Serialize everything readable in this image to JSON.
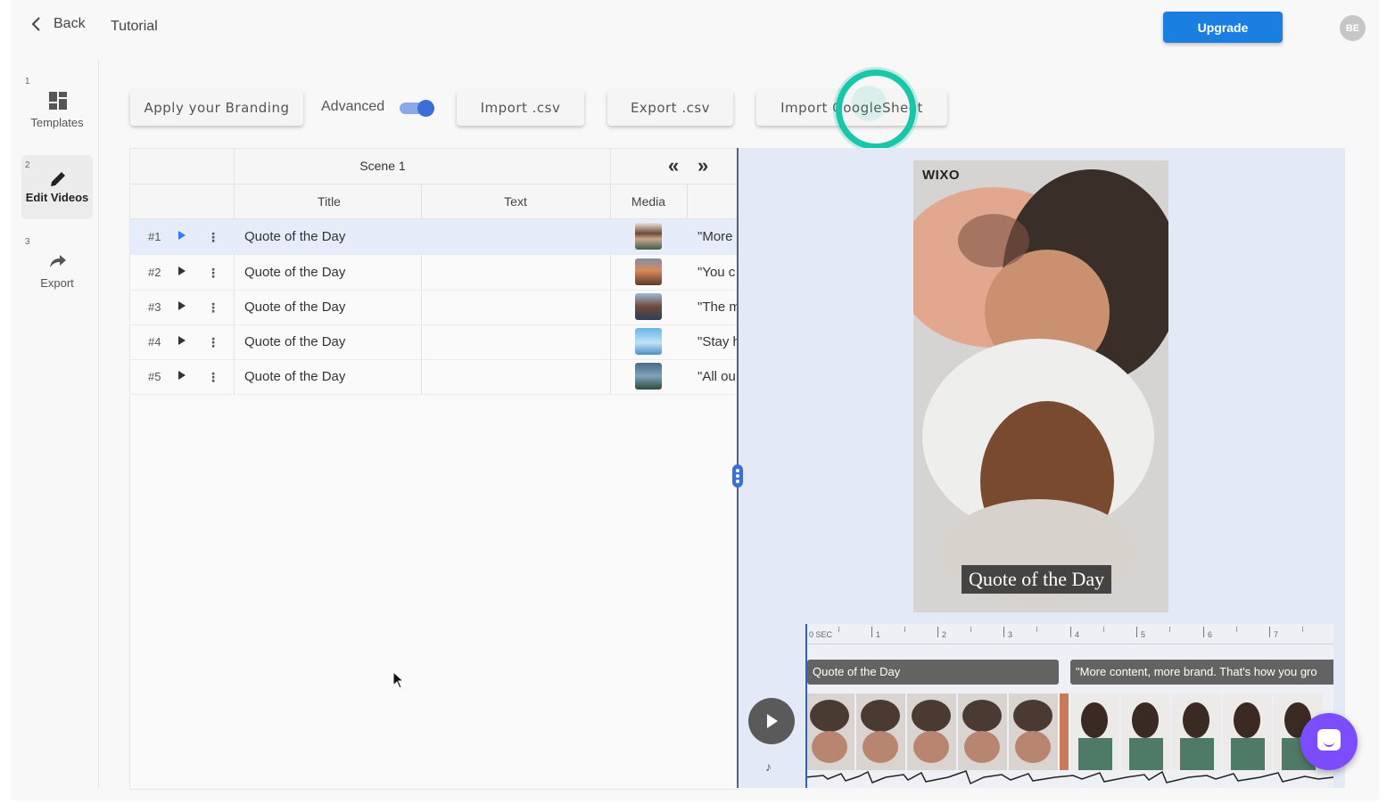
{
  "header": {
    "back_label": "Back",
    "title": "Tutorial",
    "upgrade_label": "Upgrade",
    "avatar_initials": "BE"
  },
  "sidebar": {
    "steps": [
      {
        "num": "1",
        "label": "Templates",
        "icon": "grid-icon"
      },
      {
        "num": "2",
        "label": "Edit Videos",
        "icon": "pencil-icon"
      },
      {
        "num": "3",
        "label": "Export",
        "icon": "share-icon"
      }
    ]
  },
  "toolbar": {
    "branding_label": "Apply your Branding",
    "advanced_label": "Advanced",
    "advanced_on": true,
    "import_csv_label": "Import .csv",
    "export_csv_label": "Export .csv",
    "import_sheet_label": "Import GoogleSheet"
  },
  "table": {
    "scene_label": "Scene 1",
    "prev_icon": "«",
    "next_icon": "»",
    "columns": [
      "Title",
      "Text",
      "Media"
    ],
    "rows": [
      {
        "num": "#1",
        "title": "Quote of the Day",
        "text": "",
        "quote": "\"More",
        "selected": true
      },
      {
        "num": "#2",
        "title": "Quote of the Day",
        "text": "",
        "quote": "\"You c",
        "selected": false
      },
      {
        "num": "#3",
        "title": "Quote of the Day",
        "text": "",
        "quote": "\"The m",
        "selected": false
      },
      {
        "num": "#4",
        "title": "Quote of the Day",
        "text": "",
        "quote": "\"Stay h",
        "selected": false
      },
      {
        "num": "#5",
        "title": "Quote of the Day",
        "text": "",
        "quote": "\"All ou",
        "selected": false
      }
    ]
  },
  "preview": {
    "logo": "WIXO",
    "caption": "Quote of the Day"
  },
  "timeline": {
    "ruler_labels": [
      "0 SEC",
      "1",
      "2",
      "3",
      "4",
      "5",
      "6",
      "7"
    ],
    "clips": [
      "Quote of the Day",
      "\"More content, more brand. That's how you gro"
    ]
  },
  "colors": {
    "accent": "#1a7fe0",
    "toggle": "#3b6fd8",
    "ring": "#18c6a8",
    "chat": "#7b4dff",
    "preview_bg": "#e4e9f8"
  }
}
